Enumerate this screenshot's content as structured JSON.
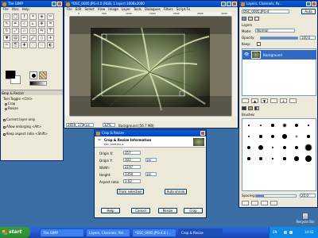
{
  "toolbox": {
    "title": "The GIMP",
    "menu": [
      "File",
      "Xtns",
      "Help"
    ],
    "tool_icons": [
      "rect-select",
      "ellipse-select",
      "free-select",
      "fuzzy-select",
      "color-select",
      "scissors",
      "paths",
      "color-picker",
      "zoom",
      "measure",
      "move",
      "crop",
      "rotate",
      "scale",
      "shear",
      "perspective",
      "flip",
      "text",
      "bucket-fill",
      "blend",
      "pencil",
      "paintbrush",
      "eraser",
      "airbrush",
      "ink",
      "clone",
      "heal",
      "convolve",
      "smudge",
      "dodge-burn"
    ],
    "options": {
      "title": "Crop & Resize",
      "tool_toggle": "Tool Toggle  <Ctrl>",
      "mode_crop": "Crop",
      "mode_resize": "Resize",
      "current_layer_only": "Current layer only",
      "allow_enlarging": "Allow enlarging  <Alt>",
      "keep_aspect": "Keep aspect ratio  <Shift>"
    }
  },
  "image_window": {
    "title": "*DSC_0005.JPG-4.0 (RGB, 1 layer) 3008x2000",
    "menu": [
      "File",
      "Edit",
      "Select",
      "View",
      "Image",
      "Layer",
      "Tools",
      "Dialogues",
      "Filters",
      "Script-Fu"
    ],
    "ruler_ticks": [
      "0",
      "500",
      "1000",
      "1500",
      "2000",
      "2500",
      "3000"
    ],
    "coords": "2659, 1719",
    "unit": "px",
    "zoom": "12%",
    "status": "Background (56.7 MB)"
  },
  "layers": {
    "title": "Layers, Channels, Pa...",
    "image_select": "DSC_0005.JPG-4",
    "auto_label": "Auto",
    "panel_title": "Layers",
    "mode_label": "Mode:",
    "mode_value": "Normal",
    "opacity_label": "Opacity:",
    "opacity_value": "100.0",
    "keep_label": "Keep:",
    "layer_name": "Background",
    "brushes_title": "Brushes",
    "spacing_label": "Spacing:",
    "spacing_value": "20.0"
  },
  "crop_dialog": {
    "title": "Crop & Resize",
    "heading": "Crop & Resize Information",
    "subheading": "DSC_0005.JPG-4",
    "origin_x_label": "Origin X:",
    "origin_x": "357",
    "origin_y_label": "Origin Y:",
    "origin_y": "303",
    "width_label": "Width:",
    "width": "2197",
    "height_label": "Height:",
    "height": "1350",
    "aspect_label": "Aspect ratio:",
    "aspect": "1.62",
    "unit": "px",
    "from_selection": "From selection",
    "auto_shrink": "Auto shrink",
    "help": "Help",
    "cancel": "Cancel",
    "resize": "Resize",
    "crop": "Crop"
  },
  "desktop": {
    "recycle_bin": "Recycle Bin"
  },
  "taskbar": {
    "start": "start",
    "items": [
      "The GIMP",
      "Layers, Channels, Pat...",
      "*DSC_0005.JPG-4.0 (...",
      "Crop & Resize"
    ],
    "lang": "EN",
    "clock": "14:02"
  }
}
